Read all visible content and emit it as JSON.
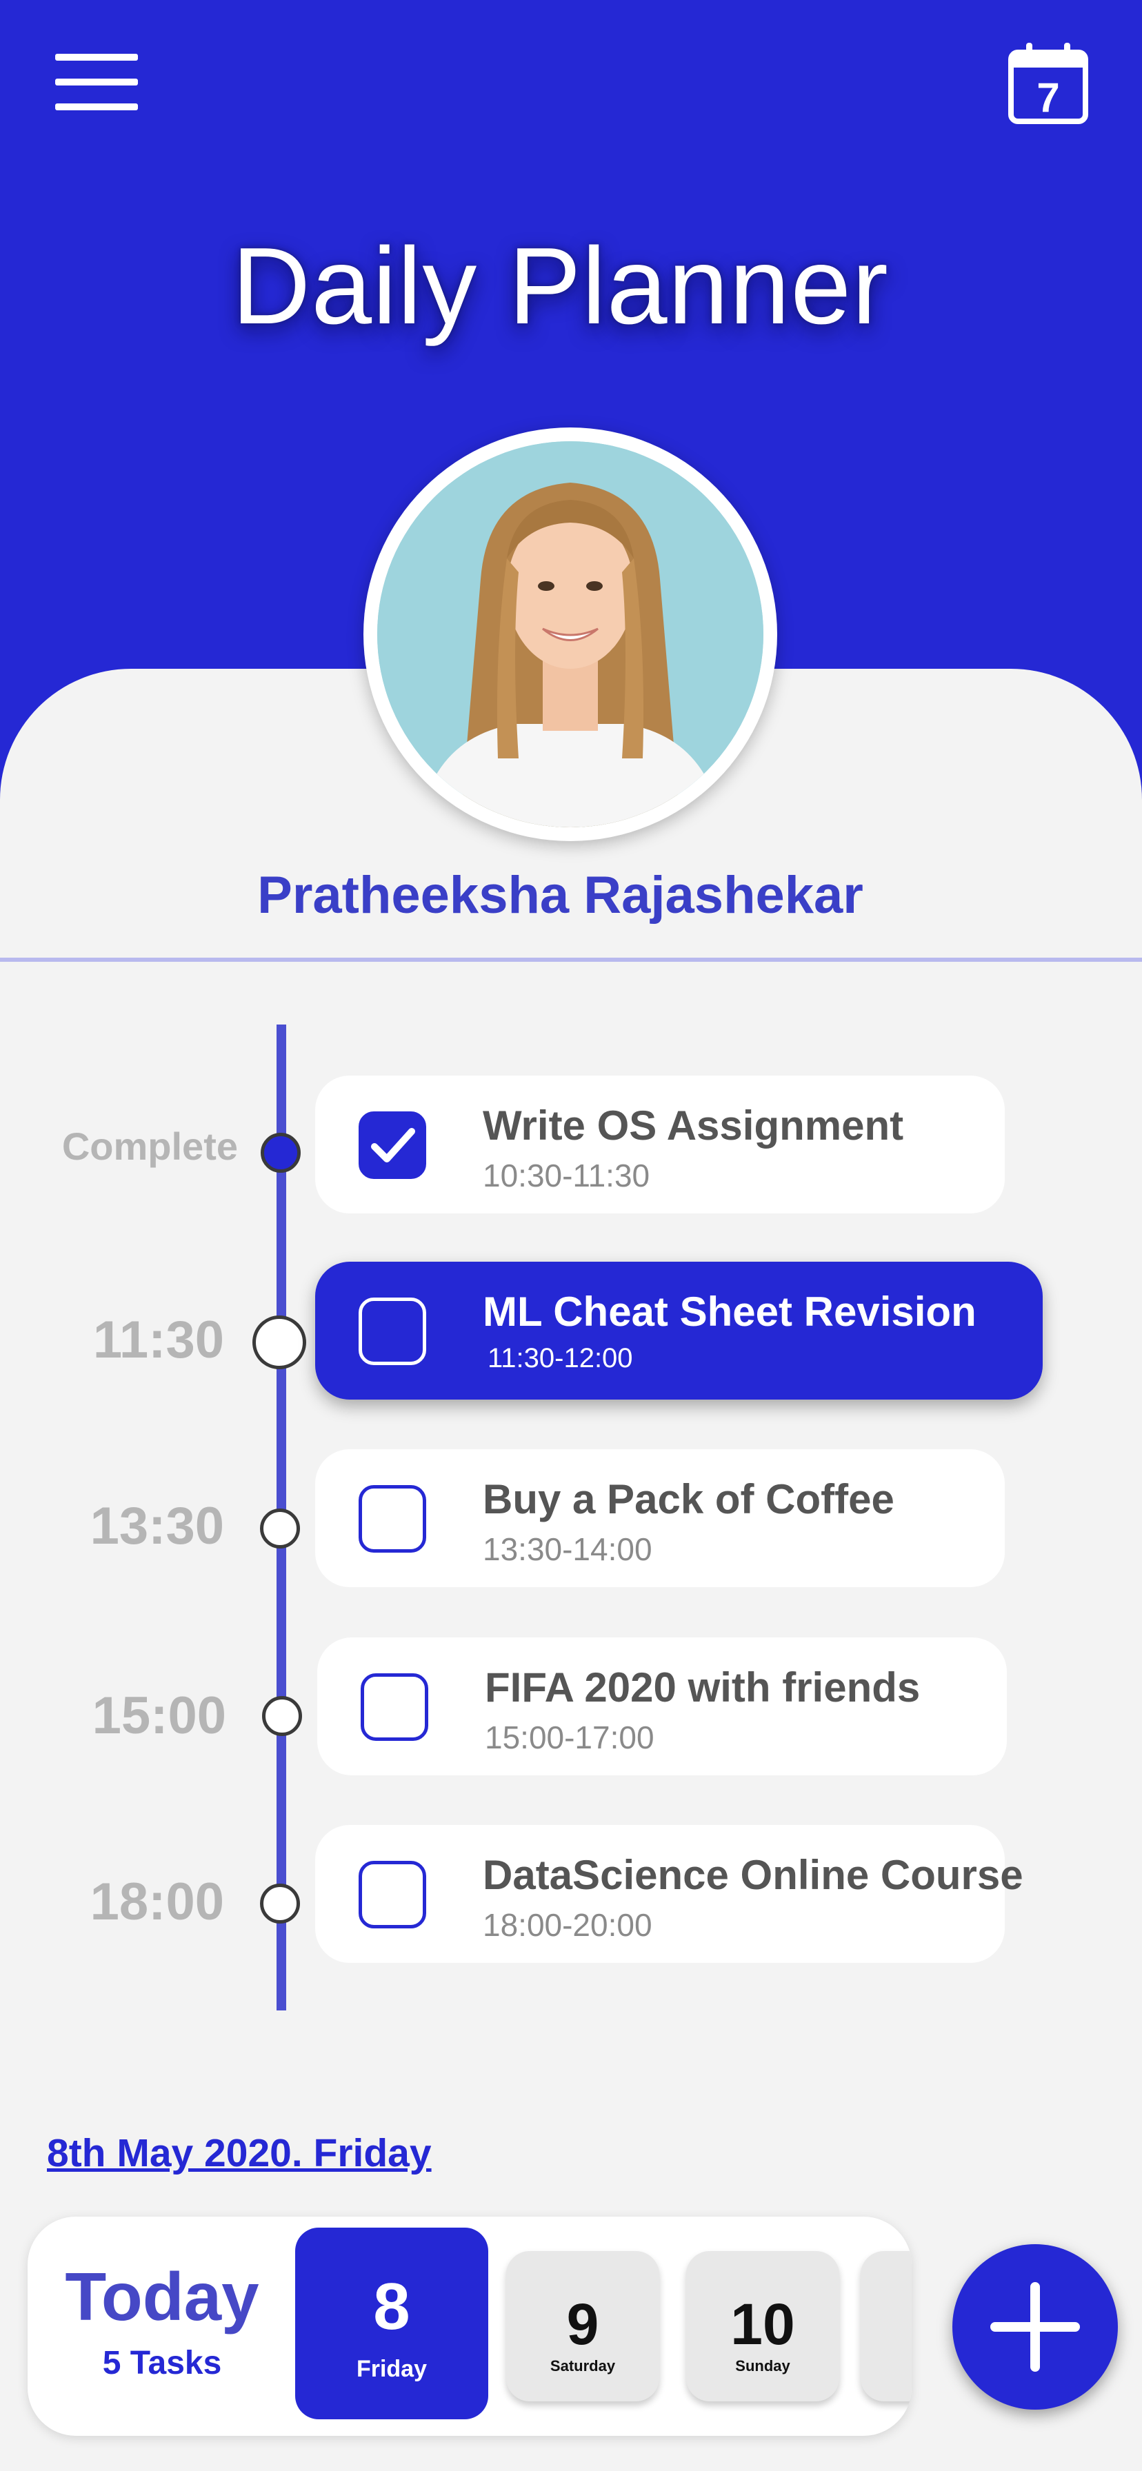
{
  "header": {
    "title": "Daily Planner",
    "calendar_icon_day": "7"
  },
  "profile": {
    "name": "Pratheeksha Rajashekar"
  },
  "timeline": {
    "tasks": [
      {
        "time_label": "Complete",
        "title": "Write OS Assignment",
        "time_range": "10:30-11:30",
        "status": "completed"
      },
      {
        "time_label": "11:30",
        "title": "ML Cheat Sheet Revision",
        "time_range": "11:30-12:00",
        "status": "current"
      },
      {
        "time_label": "13:30",
        "title": "Buy a Pack of Coffee",
        "time_range": "13:30-14:00",
        "status": "pending"
      },
      {
        "time_label": "15:00",
        "title": "FIFA 2020 with friends",
        "time_range": "15:00-17:00",
        "status": "pending"
      },
      {
        "time_label": "18:00",
        "title": "DataScience Online Course",
        "time_range": "18:00-20:00",
        "status": "pending"
      }
    ]
  },
  "footer": {
    "date_link": "8th May 2020. Friday",
    "today_label": "Today",
    "task_count": "5 Tasks",
    "days": [
      {
        "num": "8",
        "name": "Friday",
        "selected": true
      },
      {
        "num": "9",
        "name": "Saturday",
        "selected": false
      },
      {
        "num": "10",
        "name": "Sunday",
        "selected": false
      }
    ]
  },
  "colors": {
    "primary": "#2528d4",
    "accent_text": "#3a3fc7",
    "background": "#f3f3f3",
    "timeline": "#4a4ed0"
  },
  "icons": [
    "menu-icon",
    "calendar-icon",
    "checkmark-icon",
    "plus-icon"
  ]
}
